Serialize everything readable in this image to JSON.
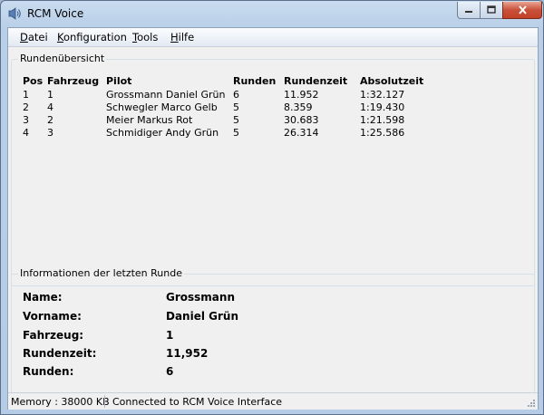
{
  "window": {
    "title": "RCM Voice"
  },
  "menu": {
    "datei": "Datei",
    "konfiguration": "Konfiguration",
    "tools": "Tools",
    "hilfe": "Hilfe"
  },
  "rounds": {
    "title": "Rundenübersicht",
    "columns": [
      "Pos",
      "Fahrzeug",
      "Pilot",
      "Runden",
      "Rundenzeit",
      "Absolutzeit"
    ],
    "rows": [
      [
        "1",
        "1",
        "Grossmann Daniel Grün",
        "6",
        "11.952",
        "1:32.127"
      ],
      [
        "2",
        "4",
        "Schwegler Marco Gelb",
        "5",
        "8.359",
        "1:19.430"
      ],
      [
        "3",
        "2",
        "Meier Markus Rot",
        "5",
        "30.683",
        "1:21.598"
      ],
      [
        "4",
        "3",
        "Schmidiger Andy Grün",
        "5",
        "26.314",
        "1:25.586"
      ]
    ]
  },
  "last_round": {
    "title": "Informationen der letzten Runde",
    "labels": {
      "name": "Name:",
      "vorname": "Vorname:",
      "fahrzeug": "Fahrzeug:",
      "rundenzeit": "Rundenzeit:",
      "runden": "Runden:"
    },
    "values": {
      "name": "Grossmann",
      "vorname": "Daniel Grün",
      "fahrzeug": "1",
      "rundenzeit": "11,952",
      "runden": "6"
    }
  },
  "status": {
    "memory": "Memory : 38000 KB",
    "connection": "Connected to RCM Voice Interface"
  }
}
